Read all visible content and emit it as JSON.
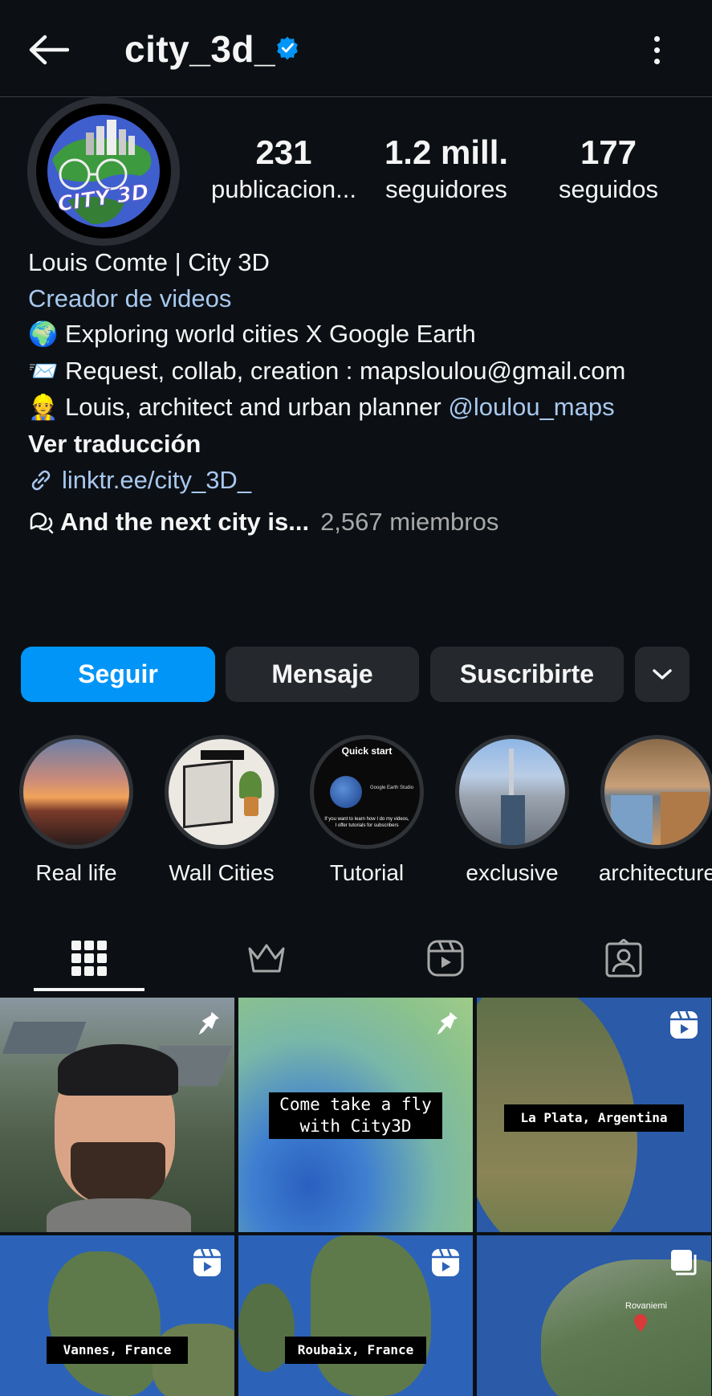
{
  "header": {
    "username": "city_3d_",
    "back_icon": "arrow-left-icon",
    "verified_icon": "verified-badge-icon",
    "more_icon": "more-vertical-icon"
  },
  "stats": {
    "posts_count": "231",
    "posts_label": "publicacion...",
    "followers_count": "1.2 mill.",
    "followers_label": "seguidores",
    "following_count": "177",
    "following_label": "seguidos"
  },
  "avatar": {
    "logo_text": "CITY 3D"
  },
  "bio": {
    "name": "Louis Comte | City 3D",
    "category": "Creador de videos",
    "line1_emoji": "🌍",
    "line1_text": "Exploring world cities X Google Earth",
    "line2_emoji": "📨",
    "line2_text": "Request, collab, creation : mapsloulou@gmail.com",
    "line3_emoji": "👷",
    "line3_text": "Louis, architect and urban planner ",
    "line3_mention": "@loulou_maps",
    "translate": "Ver traducción",
    "link": "linktr.ee/city_3D_"
  },
  "channel": {
    "name": "And the next city is...",
    "members": "2,567 miembros"
  },
  "buttons": {
    "follow": "Seguir",
    "message": "Mensaje",
    "subscribe": "Suscribirte"
  },
  "highlights": [
    {
      "label": "Real life"
    },
    {
      "label": "Wall Cities"
    },
    {
      "label": "Tutorial",
      "cover_title": "Quick start",
      "cover_sub": "Google Earth Studio",
      "cover_text": "If you want to learn how I do my videos, I offer tutorials for subscribers"
    },
    {
      "label": "exclusive"
    },
    {
      "label": "architecture"
    }
  ],
  "tabs": [
    {
      "name": "posts",
      "icon": "grid-icon"
    },
    {
      "name": "exclusive",
      "icon": "crown-icon"
    },
    {
      "name": "reels",
      "icon": "reels-icon"
    },
    {
      "name": "tagged",
      "icon": "tagged-person-icon"
    }
  ],
  "grid": [
    {
      "type": "pinned",
      "caption": ""
    },
    {
      "type": "pinned",
      "caption": "Come take a fly\nwith City3D"
    },
    {
      "type": "reel",
      "caption": "La Plata, Argentina"
    },
    {
      "type": "reel",
      "caption": "Vannes, France"
    },
    {
      "type": "reel",
      "caption": "Roubaix, France"
    },
    {
      "type": "carousel",
      "caption": "",
      "map_label": "Rovaniemi"
    }
  ],
  "colors": {
    "background": "#0c1014",
    "accent": "#0095f6",
    "link": "#a8c8ee",
    "secondary_button": "#25292e",
    "muted_text": "#a8a8a8"
  }
}
